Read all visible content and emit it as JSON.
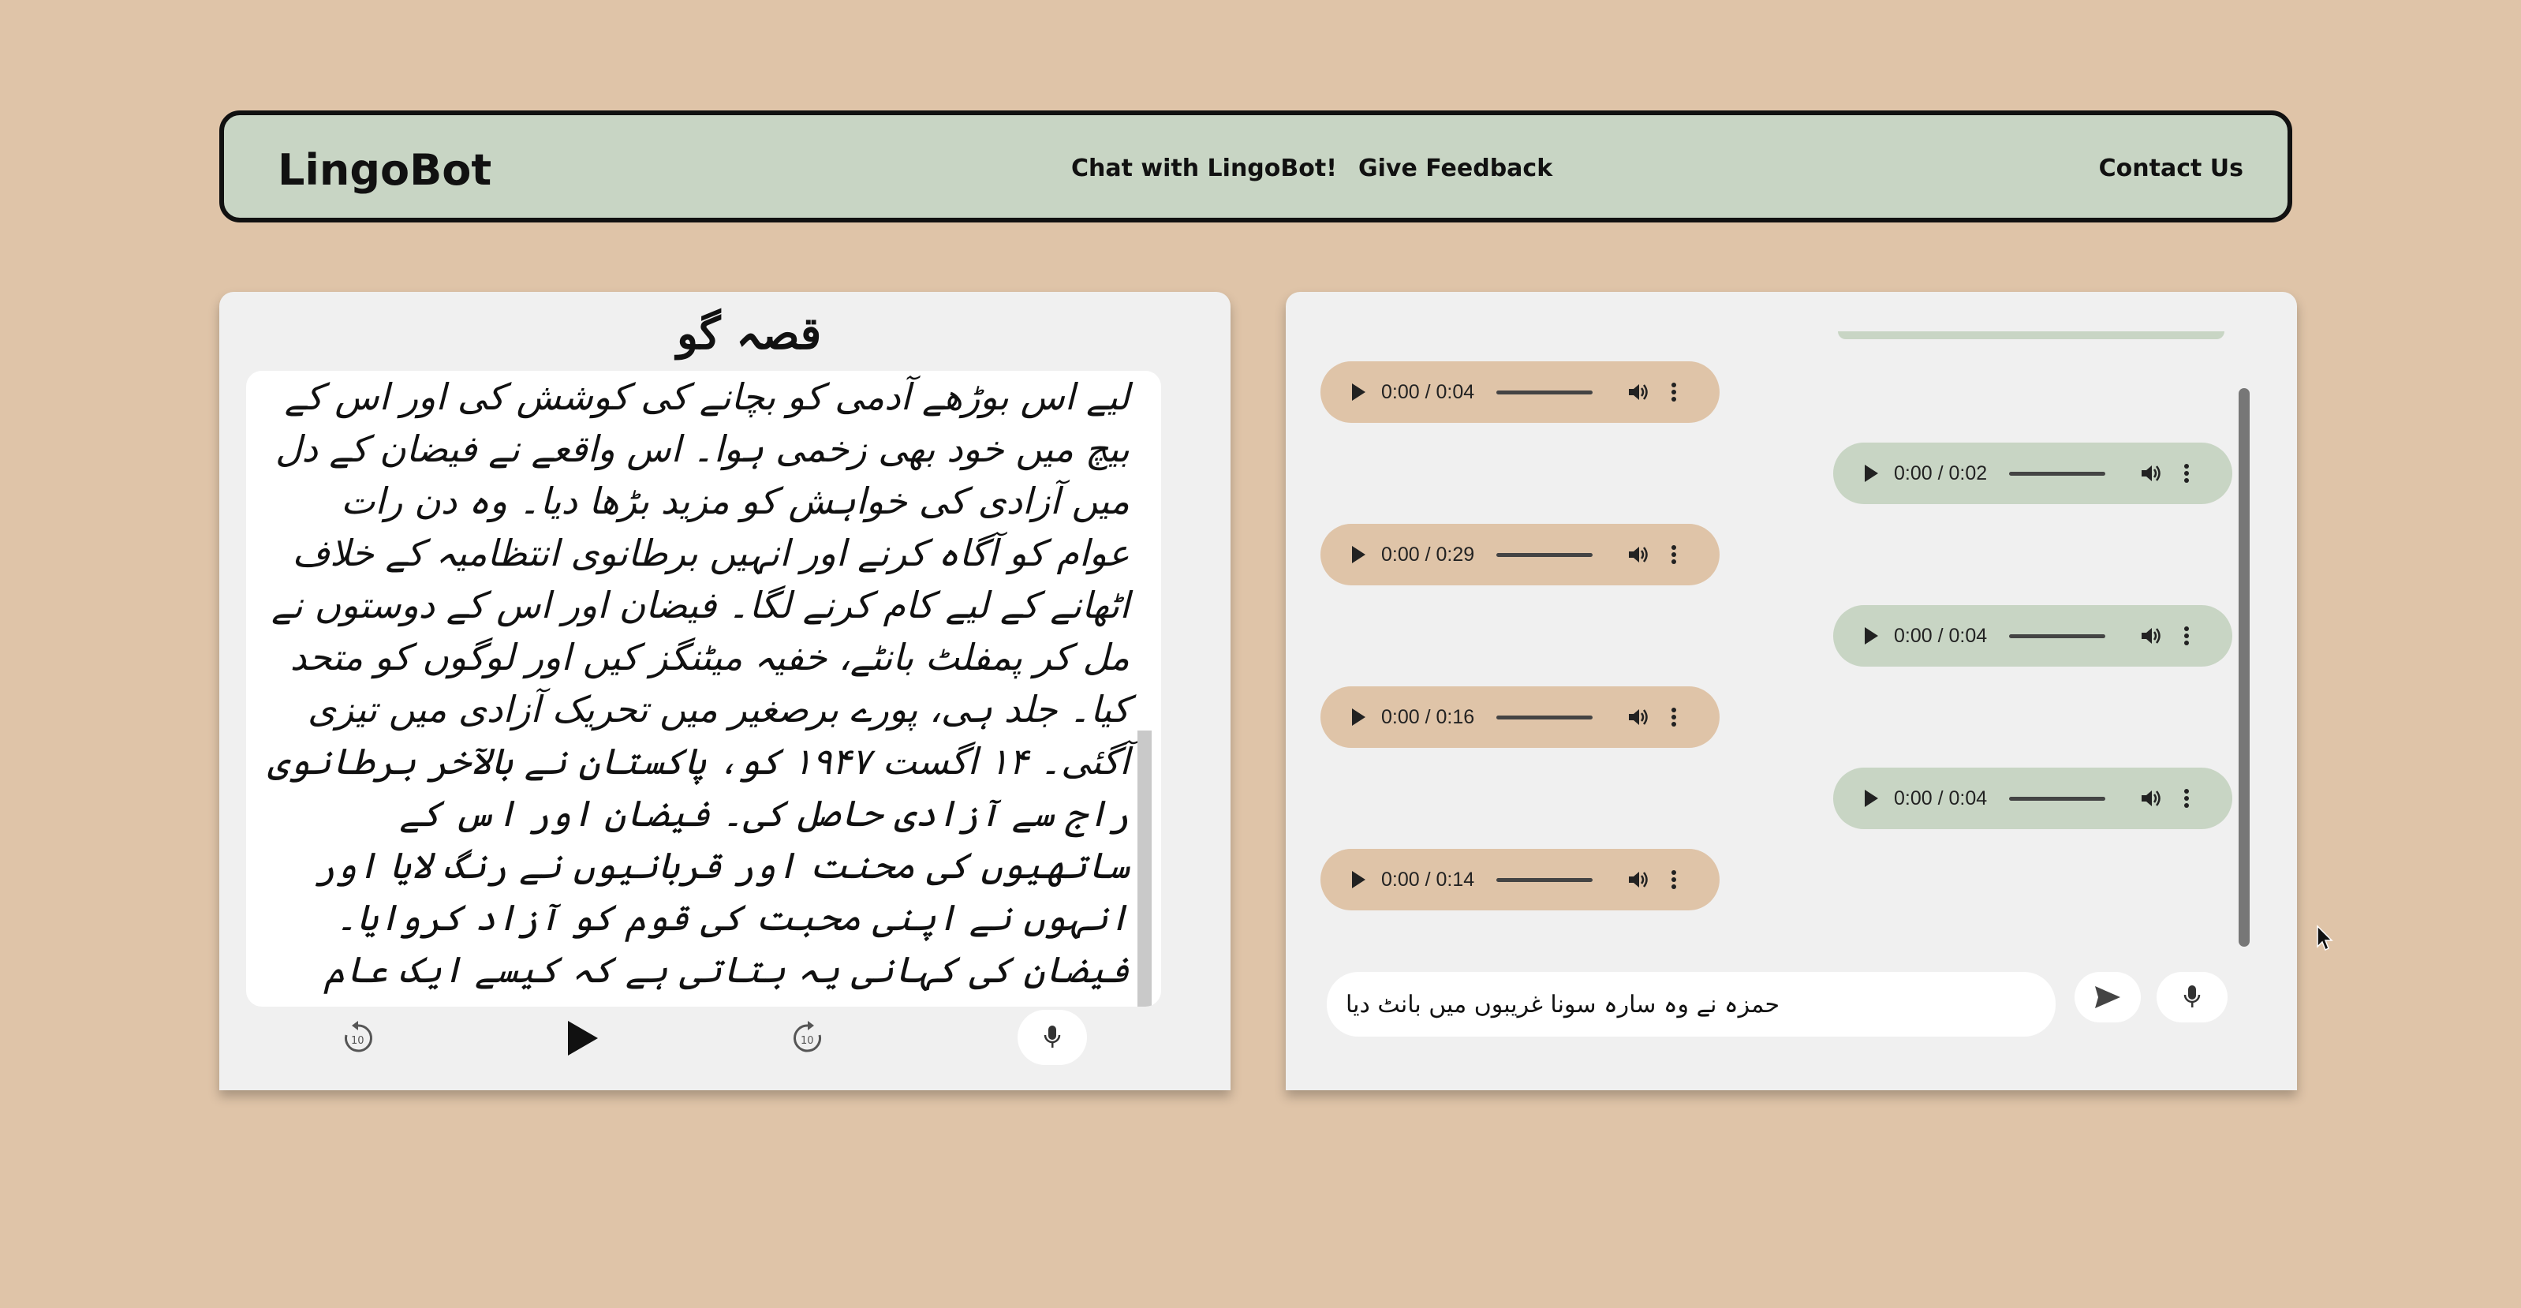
{
  "navbar": {
    "brand": "LingoBot",
    "links": {
      "chat": "Chat with LingoBot!",
      "feedback": "Give Feedback",
      "contact": "Contact Us"
    }
  },
  "story": {
    "title": "قصہ گو",
    "text": "لیے اس بوڑھے آدمی کو بچانے کی کوشش کی اور اس کے بیچ میں خود بھی زخمی ہوا۔ اس واقعے نے فیضان کے دل میں آزادی کی خواہش کو مزید بڑھا دیا۔ وہ دن رات عوام کو آگاہ کرنے اور انہیں برطانوی انتظامیہ کے خلاف اٹھانے کے لیے کام کرنے لگا۔ فیضان اور اس کے دوستوں نے مل کر پمفلٹ بانٹے، خفیہ میٹنگز کیں اور لوگوں کو متحد کیا۔ جلد ہی، پورے برصغیر میں تحریک آزادی میں تیزی آگئی۔ ۱۴ اگست ۱۹۴۷ کو، پاکستان نے بالآخر برطانوی راج سے آزادی حاصل کی۔ فیضان اور اس کے ساتھیوں کی محنت اور قربانیوں نے رنگ لایا اور انہوں نے اپنی محبت کی قوم کو آزاد کروایا۔ فیضان کی کہانی یہ بتاتی ہے کہ کیسے ایک عام نوجوان نے بہادری اور جرات کے ساتھ اپنی قوم کی آزادی کے لیے لڑائی لڑی، اور یہ کہ ہر ایک شخص کی محنت اور کوشش سے بڑے سے بڑے اہداف حاصل کیے جا سکتے ہیں۔",
    "controls": {
      "rewind_icon": "replay-10-icon",
      "play_icon": "play-icon",
      "forward_icon": "forward-10-icon",
      "mic_icon": "microphone-icon"
    }
  },
  "chat": {
    "messages": [
      {
        "side": "left",
        "time": "0:00 / 0:04"
      },
      {
        "side": "right",
        "time": "0:00 / 0:02"
      },
      {
        "side": "left",
        "time": "0:00 / 0:29"
      },
      {
        "side": "right",
        "time": "0:00 / 0:04"
      },
      {
        "side": "left",
        "time": "0:00 / 0:16"
      },
      {
        "side": "right",
        "time": "0:00 / 0:04"
      },
      {
        "side": "left",
        "time": "0:00 / 0:14"
      }
    ],
    "input_value": "حمزہ نے وہ سارہ سونا غریبوں میں بانٹ دیا",
    "send_icon": "send-icon",
    "mic_icon": "microphone-icon"
  },
  "colors": {
    "background": "#dfc4a8",
    "nav_bg": "#c8d5c4",
    "user_bubble": "#c8d5c4",
    "bot_bubble": "#dfc4a8"
  }
}
